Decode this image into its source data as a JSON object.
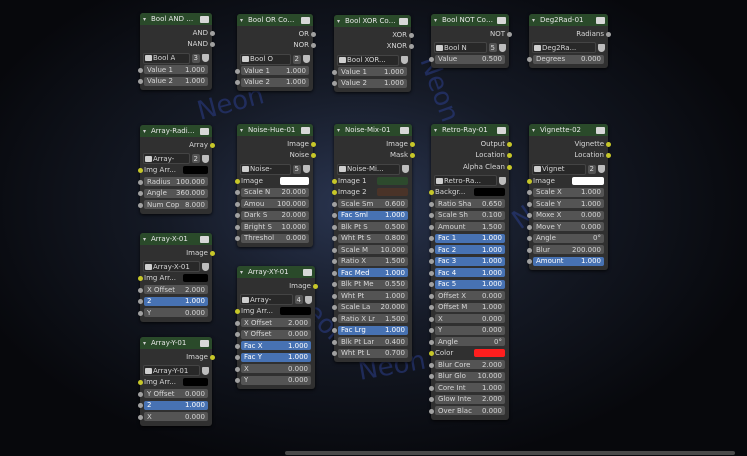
{
  "colors": {
    "header": "#2a4a2a",
    "node_bg": "#303030",
    "field": "#545454",
    "highlight": "#4772b3",
    "socket_gray": "#a1a1a1",
    "socket_yellow": "#c7c729"
  },
  "background_text": [
    "Neon",
    "Neon",
    "Neon",
    "Neon",
    "Neon",
    "Neon"
  ],
  "nodes": {
    "bool_and": {
      "title": "Bool AND Com...",
      "outputs": [
        "AND",
        "NAND"
      ],
      "selector": "Bool A",
      "users": "3",
      "inputs": [
        {
          "label": "Value 1",
          "value": "1.000"
        },
        {
          "label": "Value 2",
          "value": "1.000"
        }
      ]
    },
    "bool_or": {
      "title": "Bool OR Compo...",
      "outputs": [
        "OR",
        "NOR"
      ],
      "selector": "Bool O",
      "users": "2",
      "inputs": [
        {
          "label": "Value 1",
          "value": "1.000"
        },
        {
          "label": "Value 2",
          "value": "1.000"
        }
      ]
    },
    "bool_xor": {
      "title": "Bool XOR Com...",
      "outputs": [
        "XOR",
        "XNOR"
      ],
      "selector": "Bool XOR...",
      "inputs": [
        {
          "label": "Value 1",
          "value": "1.000"
        },
        {
          "label": "Value 2",
          "value": "1.000"
        }
      ]
    },
    "bool_not": {
      "title": "Bool NOT Com...",
      "outputs": [
        "NOT"
      ],
      "selector": "Bool N",
      "users": "5",
      "inputs": [
        {
          "label": "Value",
          "value": "0.500"
        }
      ]
    },
    "deg2rad": {
      "title": "Deg2Rad-01",
      "outputs": [
        "Radians"
      ],
      "selector": "Deg2Ra...",
      "inputs": [
        {
          "label": "Degrees",
          "value": "0.000"
        }
      ]
    },
    "array_radial": {
      "title": "Array-Radial-01",
      "outputs": [
        "Array"
      ],
      "selector": "Array-",
      "users": "2",
      "color_label": "Img Arr...",
      "inputs": [
        {
          "label": "Radius",
          "value": "100.000"
        },
        {
          "label": "Angle",
          "value": "360.000"
        },
        {
          "label": "Num Cop",
          "value": "8.000"
        }
      ]
    },
    "array_x": {
      "title": "Array-X-01",
      "outputs": [
        "Image"
      ],
      "selector": "Array-X-01",
      "color_label": "Img Arr...",
      "inputs": [
        {
          "label": "X Offset",
          "value": "2.000"
        },
        {
          "label": "2",
          "value": "1.000",
          "hl": true
        },
        {
          "label": "Y",
          "value": "0.000"
        }
      ]
    },
    "array_y": {
      "title": "Array-Y-01",
      "outputs": [
        "Image"
      ],
      "selector": "Array-Y-01",
      "color_label": "Img Arr...",
      "inputs": [
        {
          "label": "Y Offset",
          "value": "0.000"
        },
        {
          "label": "2",
          "value": "1.000",
          "hl": true
        },
        {
          "label": "X",
          "value": "0.000"
        }
      ]
    },
    "noise_hue": {
      "title": "Noise-Hue-01",
      "outputs": [
        "Image",
        "Noise"
      ],
      "selector": "Noise-",
      "users": "5",
      "color_label": "Image",
      "inputs": [
        {
          "label": "Scale N",
          "value": "20.000"
        },
        {
          "label": "Amou",
          "value": "100.000"
        },
        {
          "label": "Dark S",
          "value": "20.000"
        },
        {
          "label": "Bright S",
          "value": "10.000"
        },
        {
          "label": "Threshol",
          "value": "0.000"
        }
      ]
    },
    "array_xy": {
      "title": "Array-XY-01",
      "outputs": [
        "Image"
      ],
      "selector": "Array-",
      "users": "4",
      "color_label": "Img Arr...",
      "inputs": [
        {
          "label": "X Offset",
          "value": "2.000"
        },
        {
          "label": "Y Offset",
          "value": "0.000"
        },
        {
          "label": "Fac X",
          "value": "1.000",
          "hl": true
        },
        {
          "label": "Fac Y",
          "value": "1.000",
          "hl": true
        },
        {
          "label": "X",
          "value": "0.000"
        },
        {
          "label": "Y",
          "value": "0.000"
        }
      ]
    },
    "noise_mix": {
      "title": "Noise-Mix-01",
      "outputs": [
        "Image",
        "Mask"
      ],
      "selector": "Noise-Mi...",
      "image_inputs": [
        "Image 1",
        "Image 2"
      ],
      "inputs": [
        {
          "label": "Scale Sm",
          "value": "0.600"
        },
        {
          "label": "Fac Sml",
          "value": "1.000",
          "hl": true
        },
        {
          "label": "Blk Pt S",
          "value": "0.500"
        },
        {
          "label": "Wht Pt S",
          "value": "0.800"
        },
        {
          "label": "Scale M",
          "value": "10.000"
        },
        {
          "label": "Ratio X",
          "value": "1.500"
        },
        {
          "label": "Fac Med",
          "value": "1.000",
          "hl": true
        },
        {
          "label": "Blk Pt Me",
          "value": "0.550"
        },
        {
          "label": "Wht Pt",
          "value": "1.000"
        },
        {
          "label": "Scale La",
          "value": "20.000"
        },
        {
          "label": "Ratio X Lr",
          "value": "1.500"
        },
        {
          "label": "Fac Lrg",
          "value": "1.000",
          "hl": true
        },
        {
          "label": "Blk Pt Lar",
          "value": "0.400"
        },
        {
          "label": "Wht Pt L",
          "value": "0.700"
        }
      ]
    },
    "retro_ray": {
      "title": "Retro-Ray-01",
      "outputs": [
        "Output",
        "Location",
        "Alpha Clean"
      ],
      "selector": "Retro-Ra...",
      "color_label": "Backgr...",
      "inputs": [
        {
          "label": "Ratio Sha",
          "value": "0.650"
        },
        {
          "label": "Scale Sh",
          "value": "0.100"
        },
        {
          "label": "Amount",
          "value": "1.500"
        },
        {
          "label": "Fac 1",
          "value": "1.000",
          "hl": true
        },
        {
          "label": "Fac 2",
          "value": "1.000",
          "hl": true
        },
        {
          "label": "Fac 3",
          "value": "1.000",
          "hl": true
        },
        {
          "label": "Fac 4",
          "value": "1.000",
          "hl": true
        },
        {
          "label": "Fac 5",
          "value": "1.000",
          "hl": true
        },
        {
          "label": "Offset X",
          "value": "0.000"
        },
        {
          "label": "Offset M",
          "value": "1.000"
        },
        {
          "label": "X",
          "value": "0.000"
        },
        {
          "label": "Y",
          "value": "0.000"
        },
        {
          "label": "Angle",
          "value": "0°"
        }
      ],
      "color2_label": "Color",
      "inputs2": [
        {
          "label": "Blur Core",
          "value": "2.000"
        },
        {
          "label": "Blur Glo",
          "value": "10.000"
        },
        {
          "label": "Core Int",
          "value": "1.000"
        },
        {
          "label": "Glow Inte",
          "value": "2.000"
        },
        {
          "label": "Over Blac",
          "value": "0.000"
        }
      ]
    },
    "vignette": {
      "title": "Vignette-02",
      "outputs": [
        "Vignette",
        "Location"
      ],
      "selector": "Vignet",
      "users": "2",
      "color_label": "Image",
      "inputs": [
        {
          "label": "Scale X",
          "value": "1.000"
        },
        {
          "label": "Scale Y",
          "value": "1.000"
        },
        {
          "label": "Moxe X",
          "value": "0.000"
        },
        {
          "label": "Move Y",
          "value": "0.000"
        },
        {
          "label": "Angle",
          "value": "0°"
        },
        {
          "label": "Blur",
          "value": "200.000"
        },
        {
          "label": "Amount",
          "value": "1.000",
          "hl": true
        }
      ]
    }
  }
}
